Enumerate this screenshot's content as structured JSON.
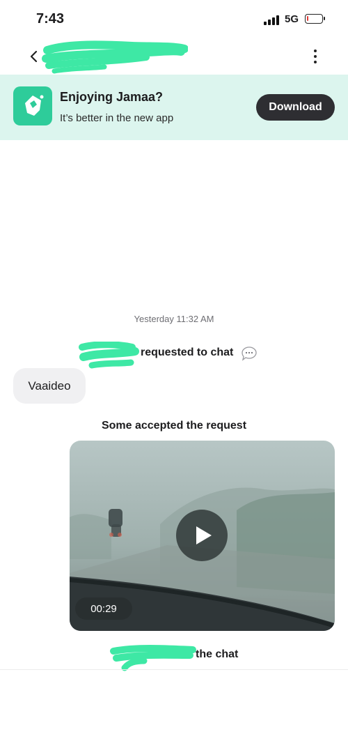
{
  "status_bar": {
    "time": "7:43",
    "network": "5G",
    "battery_level": 0.08
  },
  "header": {
    "back_icon": "chevron-left-icon",
    "menu_icon": "vertical-dots-icon"
  },
  "banner": {
    "title": "Enjoying Jamaa?",
    "subtitle": "It’s better in the new app",
    "download_label": "Download",
    "background": "#dcf5ee",
    "icon_color": "#2ecc9a"
  },
  "chat": {
    "timestamp": "Yesterday 11:32 AM",
    "request_text": "requested to chat",
    "request_icon": "chat-bubble-icon",
    "message": "Vaaideo",
    "accepted_text": "Some accepted the request",
    "video": {
      "duration": "00:29",
      "play_icon": "play-icon"
    },
    "left_text": "the chat"
  },
  "colors": {
    "redaction": "#3ee8a5",
    "button_dark": "#2e2e32"
  }
}
